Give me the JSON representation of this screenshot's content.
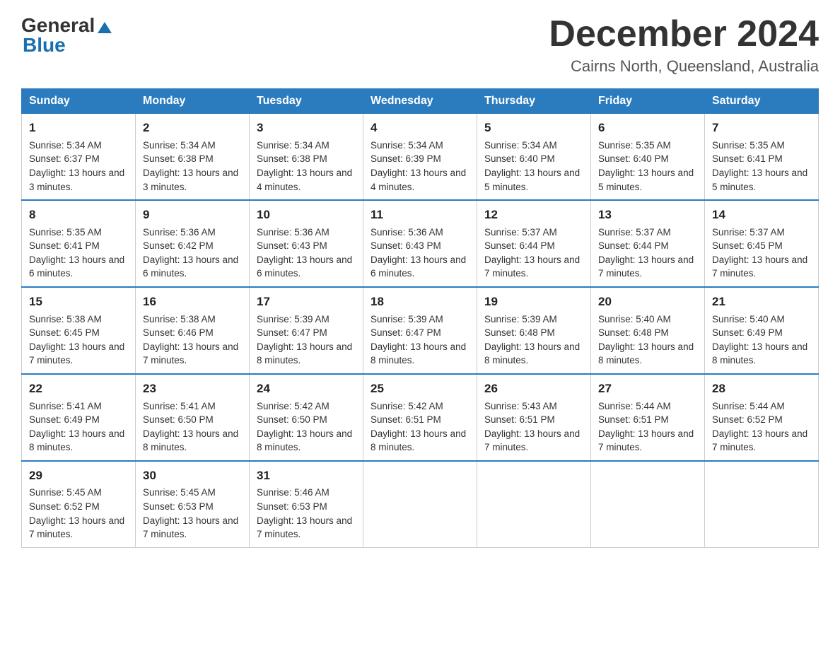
{
  "header": {
    "logo_general": "General",
    "logo_blue": "Blue",
    "month_year": "December 2024",
    "location": "Cairns North, Queensland, Australia"
  },
  "days_of_week": [
    "Sunday",
    "Monday",
    "Tuesday",
    "Wednesday",
    "Thursday",
    "Friday",
    "Saturday"
  ],
  "weeks": [
    [
      {
        "day": "1",
        "sunrise": "5:34 AM",
        "sunset": "6:37 PM",
        "daylight": "13 hours and 3 minutes."
      },
      {
        "day": "2",
        "sunrise": "5:34 AM",
        "sunset": "6:38 PM",
        "daylight": "13 hours and 3 minutes."
      },
      {
        "day": "3",
        "sunrise": "5:34 AM",
        "sunset": "6:38 PM",
        "daylight": "13 hours and 4 minutes."
      },
      {
        "day": "4",
        "sunrise": "5:34 AM",
        "sunset": "6:39 PM",
        "daylight": "13 hours and 4 minutes."
      },
      {
        "day": "5",
        "sunrise": "5:34 AM",
        "sunset": "6:40 PM",
        "daylight": "13 hours and 5 minutes."
      },
      {
        "day": "6",
        "sunrise": "5:35 AM",
        "sunset": "6:40 PM",
        "daylight": "13 hours and 5 minutes."
      },
      {
        "day": "7",
        "sunrise": "5:35 AM",
        "sunset": "6:41 PM",
        "daylight": "13 hours and 5 minutes."
      }
    ],
    [
      {
        "day": "8",
        "sunrise": "5:35 AM",
        "sunset": "6:41 PM",
        "daylight": "13 hours and 6 minutes."
      },
      {
        "day": "9",
        "sunrise": "5:36 AM",
        "sunset": "6:42 PM",
        "daylight": "13 hours and 6 minutes."
      },
      {
        "day": "10",
        "sunrise": "5:36 AM",
        "sunset": "6:43 PM",
        "daylight": "13 hours and 6 minutes."
      },
      {
        "day": "11",
        "sunrise": "5:36 AM",
        "sunset": "6:43 PM",
        "daylight": "13 hours and 6 minutes."
      },
      {
        "day": "12",
        "sunrise": "5:37 AM",
        "sunset": "6:44 PM",
        "daylight": "13 hours and 7 minutes."
      },
      {
        "day": "13",
        "sunrise": "5:37 AM",
        "sunset": "6:44 PM",
        "daylight": "13 hours and 7 minutes."
      },
      {
        "day": "14",
        "sunrise": "5:37 AM",
        "sunset": "6:45 PM",
        "daylight": "13 hours and 7 minutes."
      }
    ],
    [
      {
        "day": "15",
        "sunrise": "5:38 AM",
        "sunset": "6:45 PM",
        "daylight": "13 hours and 7 minutes."
      },
      {
        "day": "16",
        "sunrise": "5:38 AM",
        "sunset": "6:46 PM",
        "daylight": "13 hours and 7 minutes."
      },
      {
        "day": "17",
        "sunrise": "5:39 AM",
        "sunset": "6:47 PM",
        "daylight": "13 hours and 8 minutes."
      },
      {
        "day": "18",
        "sunrise": "5:39 AM",
        "sunset": "6:47 PM",
        "daylight": "13 hours and 8 minutes."
      },
      {
        "day": "19",
        "sunrise": "5:39 AM",
        "sunset": "6:48 PM",
        "daylight": "13 hours and 8 minutes."
      },
      {
        "day": "20",
        "sunrise": "5:40 AM",
        "sunset": "6:48 PM",
        "daylight": "13 hours and 8 minutes."
      },
      {
        "day": "21",
        "sunrise": "5:40 AM",
        "sunset": "6:49 PM",
        "daylight": "13 hours and 8 minutes."
      }
    ],
    [
      {
        "day": "22",
        "sunrise": "5:41 AM",
        "sunset": "6:49 PM",
        "daylight": "13 hours and 8 minutes."
      },
      {
        "day": "23",
        "sunrise": "5:41 AM",
        "sunset": "6:50 PM",
        "daylight": "13 hours and 8 minutes."
      },
      {
        "day": "24",
        "sunrise": "5:42 AM",
        "sunset": "6:50 PM",
        "daylight": "13 hours and 8 minutes."
      },
      {
        "day": "25",
        "sunrise": "5:42 AM",
        "sunset": "6:51 PM",
        "daylight": "13 hours and 8 minutes."
      },
      {
        "day": "26",
        "sunrise": "5:43 AM",
        "sunset": "6:51 PM",
        "daylight": "13 hours and 7 minutes."
      },
      {
        "day": "27",
        "sunrise": "5:44 AM",
        "sunset": "6:51 PM",
        "daylight": "13 hours and 7 minutes."
      },
      {
        "day": "28",
        "sunrise": "5:44 AM",
        "sunset": "6:52 PM",
        "daylight": "13 hours and 7 minutes."
      }
    ],
    [
      {
        "day": "29",
        "sunrise": "5:45 AM",
        "sunset": "6:52 PM",
        "daylight": "13 hours and 7 minutes."
      },
      {
        "day": "30",
        "sunrise": "5:45 AM",
        "sunset": "6:53 PM",
        "daylight": "13 hours and 7 minutes."
      },
      {
        "day": "31",
        "sunrise": "5:46 AM",
        "sunset": "6:53 PM",
        "daylight": "13 hours and 7 minutes."
      },
      null,
      null,
      null,
      null
    ]
  ]
}
